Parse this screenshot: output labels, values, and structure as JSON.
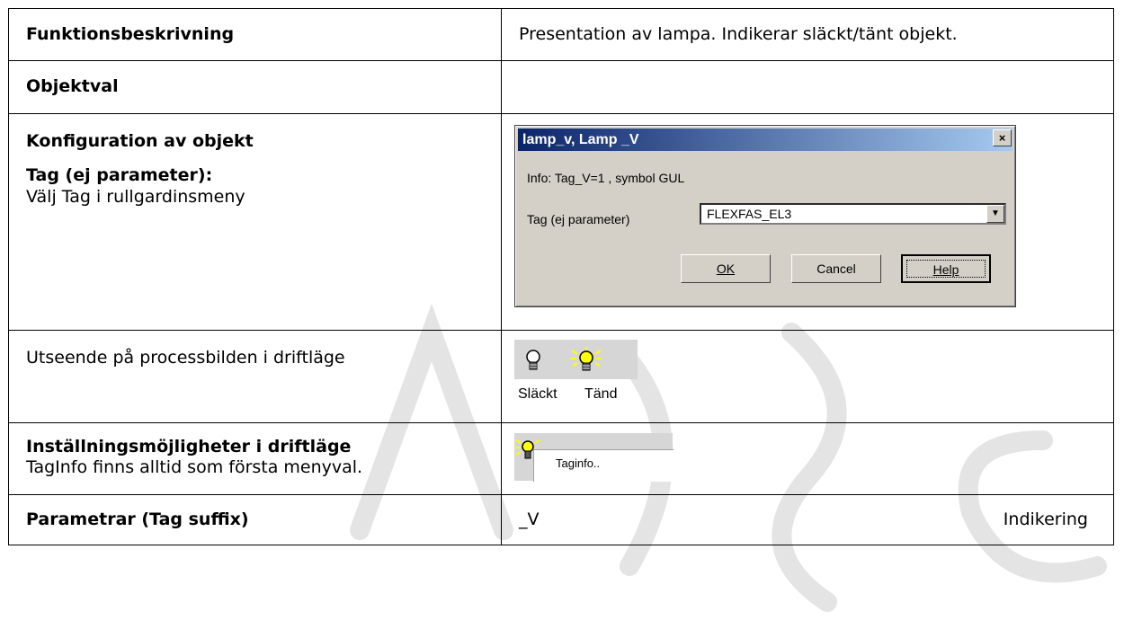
{
  "rows": {
    "function": {
      "label": "Funktionsbeskrivning",
      "value": "Presentation av lampa. Indikerar släckt/tänt objekt."
    },
    "objectsel": {
      "label": "Objektval"
    },
    "config": {
      "label": "Konfiguration av objekt",
      "tag_label": "Tag (ej parameter):",
      "tag_desc": "Välj Tag i rullgardinsmeny"
    },
    "appearance": {
      "label": "Utseende på processbilden i driftläge",
      "off_label": "Släckt",
      "on_label": "Tänd"
    },
    "settings": {
      "label": "Inställningsmöjligheter i driftläge",
      "desc": "TagInfo finns alltid som första menyval.",
      "menu_item": "Taginfo.."
    },
    "params": {
      "label": "Parametrar (Tag suffix)",
      "suffix": "_V",
      "meaning": "Indikering"
    }
  },
  "dialog": {
    "title": "lamp_v, Lamp _V",
    "close": "×",
    "info": "Info: Tag_V=1 , symbol GUL",
    "tag_label": "Tag (ej parameter)",
    "tag_value": "FLEXFAS_EL3",
    "ok_label": "OK",
    "cancel_label": "Cancel",
    "help_label": "Help"
  },
  "colors": {
    "titlebar_start": "#0a246a",
    "dialog_face": "#d4d0c8",
    "lamp_on": "#ffff00",
    "watermark": "#e6e6e6"
  },
  "icons": [
    "bulb-off-icon",
    "bulb-on-icon",
    "close-icon",
    "dropdown-arrow-icon"
  ]
}
